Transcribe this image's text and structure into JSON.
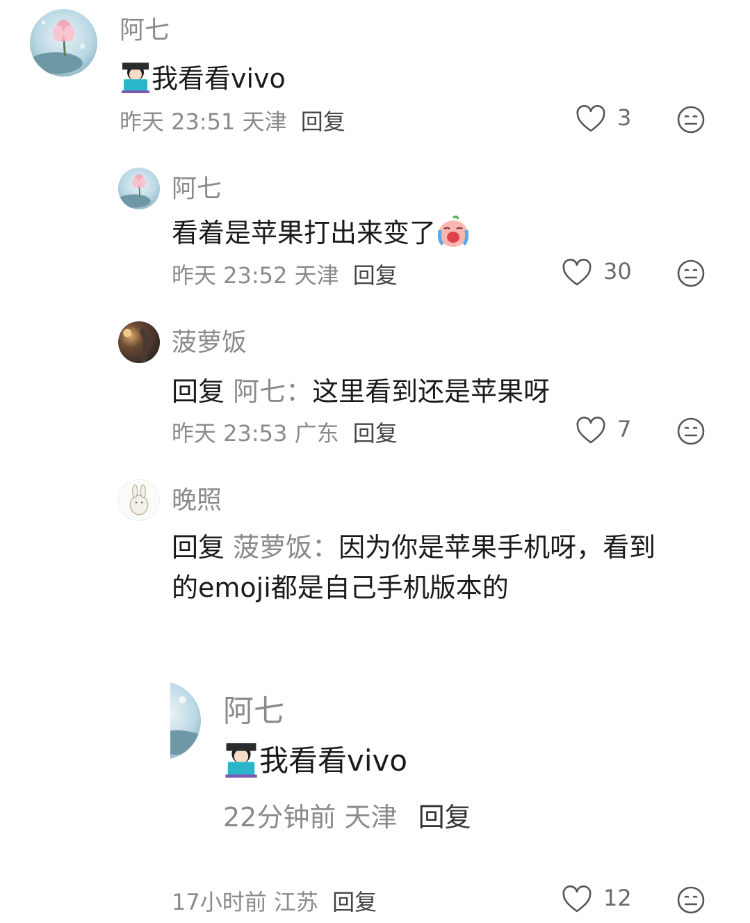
{
  "comments": [
    {
      "name": "阿七",
      "emoji": "woman-technologist",
      "text": "我看看vivo",
      "time": "昨天 23:51",
      "location": "天津",
      "reply_label": "回复",
      "likes": "3"
    },
    {
      "name": "阿七",
      "text": "看着是苹果打出来变了",
      "emoji": "crying-face",
      "time": "昨天 23:52",
      "location": "天津",
      "reply_label": "回复",
      "likes": "30"
    },
    {
      "name": "菠萝饭",
      "reply_prefix": "回复",
      "mention": "阿七：",
      "text": "这里看到还是苹果呀",
      "time": "昨天 23:53",
      "location": "广东",
      "reply_label": "回复",
      "likes": "7"
    },
    {
      "name": "晚照",
      "reply_prefix": "回复",
      "mention": "菠萝饭：",
      "text_line1": "因为你是苹果手机呀，看到",
      "text_line2": "的emoji都是自己手机版本的"
    },
    {
      "name": "阿七",
      "emoji": "woman-technologist",
      "text": "我看看vivo",
      "time": "22分钟前",
      "location": "天津",
      "reply_label": "回复"
    }
  ],
  "bottom_meta": {
    "time": "17小时前",
    "location": "江苏",
    "reply_label": "回复",
    "likes": "12"
  },
  "icons": {
    "like": "heart-outline-icon",
    "react": "expressionless-face-icon"
  },
  "colors": {
    "name": "#8a8a8a",
    "text": "#1a1a1a",
    "meta": "#8a8a8a"
  }
}
